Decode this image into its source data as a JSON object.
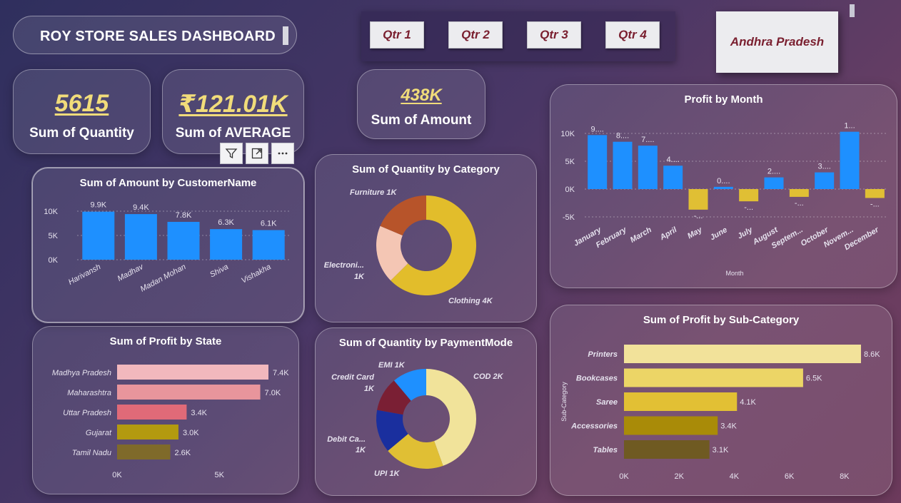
{
  "header": {
    "title": "ROY STORE SALES DASHBOARD"
  },
  "quarters": [
    "Qtr 1",
    "Qtr 2",
    "Qtr 3",
    "Qtr 4"
  ],
  "state_slicer": {
    "selected": "Andhra Pradesh"
  },
  "kpis": {
    "quantity": {
      "value": "5615",
      "label": "Sum of Quantity"
    },
    "average": {
      "value": "₹121.01K",
      "label": "Sum of AVERAGE"
    },
    "amount": {
      "value": "438K",
      "label": "Sum of Amount"
    }
  },
  "colors": {
    "accent_blue": "#1e90ff",
    "gold": "#f1dc7a"
  },
  "charts": {
    "customer": {
      "title": "Sum of Amount by CustomerName",
      "categories": [
        "Harivansh",
        "Madhav",
        "Madan Mohan",
        "Shiva",
        "Vishakha"
      ],
      "values": [
        9900,
        9400,
        7800,
        6300,
        6100
      ],
      "labels": [
        "9.9K",
        "9.4K",
        "7.8K",
        "6.3K",
        "6.1K"
      ],
      "yticks": [
        "0K",
        "5K",
        "10K"
      ]
    },
    "category": {
      "title": "Sum of Quantity by Category",
      "slices": [
        {
          "name": "Clothing",
          "value": 3516,
          "label": "Clothing 4K",
          "color": "#e2bd2b"
        },
        {
          "name": "Electronics",
          "value": 1052,
          "label": "Electroni...",
          "label2": "1K",
          "color": "#f4c6b4"
        },
        {
          "name": "Furniture",
          "value": 1047,
          "label": "Furniture 1K",
          "color": "#b7542a"
        }
      ]
    },
    "payment": {
      "title": "Sum of Quantity by PaymentMode",
      "slices": [
        {
          "name": "COD",
          "value": 2500,
          "label": "COD 2K",
          "color": "#f1e39a"
        },
        {
          "name": "UPI",
          "value": 1090,
          "label": "UPI 1K",
          "color": "#e0bf34"
        },
        {
          "name": "Debit Card",
          "value": 780,
          "label": "Debit Ca...",
          "label2": "1K",
          "color": "#1a2f9e"
        },
        {
          "name": "Credit Card",
          "value": 620,
          "label": "Credit Card",
          "label2": "1K",
          "color": "#7a1f34"
        },
        {
          "name": "EMI",
          "value": 625,
          "label": "EMI 1K",
          "color": "#1e90ff"
        }
      ]
    },
    "state": {
      "title": "Sum of Profit by State",
      "categories": [
        "Madhya Pradesh",
        "Maharashtra",
        "Uttar Pradesh",
        "Gujarat",
        "Tamil Nadu"
      ],
      "values": [
        7400,
        7000,
        3400,
        3000,
        2600
      ],
      "labels": [
        "7.4K",
        "7.0K",
        "3.4K",
        "3.0K",
        "2.6K"
      ],
      "colors": [
        "#f2b8bd",
        "#e8959c",
        "#e06a78",
        "#b39a0f",
        "#7f6a2a"
      ],
      "xticks": [
        "0K",
        "5K"
      ]
    },
    "month": {
      "title": "Profit by Month",
      "categories": [
        "January",
        "February",
        "March",
        "April",
        "May",
        "June",
        "July",
        "August",
        "Septem...",
        "October",
        "Novem...",
        "December"
      ],
      "values": [
        9700,
        8500,
        7800,
        4200,
        -3700,
        400,
        -2200,
        2100,
        -1400,
        3000,
        10300,
        -1600
      ],
      "labels": [
        "9....",
        "8....",
        "7....",
        "4....",
        "-...",
        "0....",
        "-...",
        "2....",
        "-...",
        "3....",
        "1...",
        "-..."
      ],
      "yticks": [
        "-5K",
        "0K",
        "5K",
        "10K"
      ],
      "xlabel": "Month"
    },
    "subcat": {
      "title": "Sum of Profit by Sub-Category",
      "categories": [
        "Printers",
        "Bookcases",
        "Saree",
        "Accessories",
        "Tables"
      ],
      "values": [
        8600,
        6500,
        4100,
        3400,
        3100
      ],
      "labels": [
        "8.6K",
        "6.5K",
        "4.1K",
        "3.4K",
        "3.1K"
      ],
      "colors": [
        "#f2e29a",
        "#ecd566",
        "#e2c034",
        "#a98b08",
        "#6f5a22"
      ],
      "xticks": [
        "0K",
        "2K",
        "4K",
        "6K",
        "8K"
      ],
      "ylabel": "Sub-Category"
    }
  },
  "chart_data": [
    {
      "type": "bar",
      "title": "Sum of Amount by CustomerName",
      "categories": [
        "Harivansh",
        "Madhav",
        "Madan Mohan",
        "Shiva",
        "Vishakha"
      ],
      "values": [
        9900,
        9400,
        7800,
        6300,
        6100
      ],
      "ylim": [
        0,
        10000
      ]
    },
    {
      "type": "pie",
      "title": "Sum of Quantity by Category",
      "categories": [
        "Clothing",
        "Electronics",
        "Furniture"
      ],
      "values": [
        3516,
        1052,
        1047
      ]
    },
    {
      "type": "pie",
      "title": "Sum of Quantity by PaymentMode",
      "categories": [
        "COD",
        "UPI",
        "Debit Card",
        "Credit Card",
        "EMI"
      ],
      "values": [
        2500,
        1090,
        780,
        620,
        625
      ]
    },
    {
      "type": "bar",
      "title": "Sum of Profit by State",
      "categories": [
        "Madhya Pradesh",
        "Maharashtra",
        "Uttar Pradesh",
        "Gujarat",
        "Tamil Nadu"
      ],
      "values": [
        7400,
        7000,
        3400,
        3000,
        2600
      ]
    },
    {
      "type": "bar",
      "title": "Profit by Month",
      "xlabel": "Month",
      "categories": [
        "January",
        "February",
        "March",
        "April",
        "May",
        "June",
        "July",
        "August",
        "September",
        "October",
        "November",
        "December"
      ],
      "values": [
        9700,
        8500,
        7800,
        4200,
        -3700,
        400,
        -2200,
        2100,
        -1400,
        3000,
        10300,
        -1600
      ],
      "ylim": [
        -5000,
        10000
      ]
    },
    {
      "type": "bar",
      "title": "Sum of Profit by Sub-Category",
      "ylabel": "Sub-Category",
      "categories": [
        "Printers",
        "Bookcases",
        "Saree",
        "Accessories",
        "Tables"
      ],
      "values": [
        8600,
        6500,
        4100,
        3400,
        3100
      ],
      "xlim": [
        0,
        8000
      ]
    }
  ]
}
